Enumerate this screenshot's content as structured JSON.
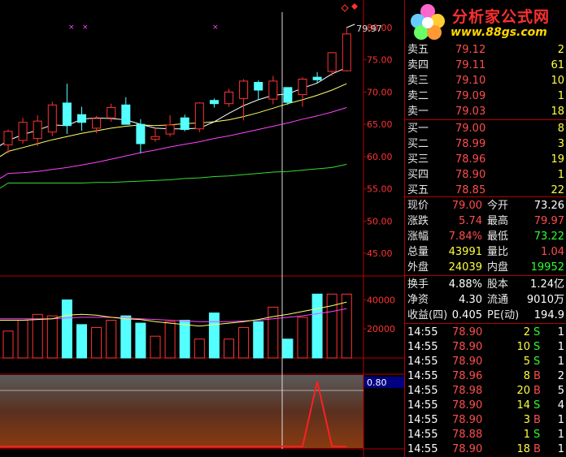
{
  "logo": {
    "title": "分析家公式网",
    "url": "www.88gs.com"
  },
  "price_axis": {
    "ticks": [
      "80.00",
      "75.00",
      "70.00",
      "65.00",
      "60.00",
      "55.00",
      "50.00",
      "45.00"
    ],
    "hi_label": "79.97"
  },
  "volume_axis": {
    "ticks": [
      "40000",
      "20000"
    ]
  },
  "indicator": {
    "value_label": "0.80"
  },
  "order_book": {
    "asks": [
      {
        "label": "卖五",
        "price": "79.12",
        "vol": "2"
      },
      {
        "label": "卖四",
        "price": "79.11",
        "vol": "61"
      },
      {
        "label": "卖三",
        "price": "79.10",
        "vol": "10"
      },
      {
        "label": "卖二",
        "price": "79.09",
        "vol": "1"
      },
      {
        "label": "卖一",
        "price": "79.03",
        "vol": "18"
      }
    ],
    "bids": [
      {
        "label": "买一",
        "price": "79.00",
        "vol": "8"
      },
      {
        "label": "买二",
        "price": "78.99",
        "vol": "3"
      },
      {
        "label": "买三",
        "price": "78.96",
        "vol": "19"
      },
      {
        "label": "买四",
        "price": "78.90",
        "vol": "1"
      },
      {
        "label": "买五",
        "price": "78.85",
        "vol": "22"
      }
    ]
  },
  "quote": [
    {
      "l1": "现价",
      "v1": "79.00",
      "l2": "今开",
      "v2": "73.26"
    },
    {
      "l1": "涨跌",
      "v1": "5.74",
      "l2": "最高",
      "v2": "79.97"
    },
    {
      "l1": "涨幅",
      "v1": "7.84%",
      "l2": "最低",
      "v2": "73.22"
    },
    {
      "l1": "总量",
      "v1": "43991",
      "l2": "量比",
      "v2": "1.04"
    },
    {
      "l1": "外盘",
      "v1": "24039",
      "l2": "内盘",
      "v2": "19952"
    }
  ],
  "fundamentals": [
    {
      "l1": "换手",
      "v1": "4.88%",
      "l2": "股本",
      "v2": "1.24亿"
    },
    {
      "l1": "净资",
      "v1": "4.30",
      "l2": "流通",
      "v2": "9010万"
    },
    {
      "l1": "收益(四)",
      "v1": "0.405",
      "l2": "PE(动)",
      "v2": "194.9"
    }
  ],
  "ticks": [
    {
      "time": "14:55",
      "price": "78.90",
      "vol": "2",
      "side": "S",
      "n": "1"
    },
    {
      "time": "14:55",
      "price": "78.90",
      "vol": "10",
      "side": "S",
      "n": "1"
    },
    {
      "time": "14:55",
      "price": "78.90",
      "vol": "5",
      "side": "S",
      "n": "1"
    },
    {
      "time": "14:55",
      "price": "78.96",
      "vol": "8",
      "side": "B",
      "n": "2"
    },
    {
      "time": "14:55",
      "price": "78.98",
      "vol": "20",
      "side": "B",
      "n": "5"
    },
    {
      "time": "14:55",
      "price": "78.90",
      "vol": "14",
      "side": "S",
      "n": "4"
    },
    {
      "time": "14:55",
      "price": "78.90",
      "vol": "3",
      "side": "B",
      "n": "1"
    },
    {
      "time": "14:55",
      "price": "78.88",
      "vol": "1",
      "side": "S",
      "n": "1"
    },
    {
      "time": "14:55",
      "price": "78.90",
      "vol": "18",
      "side": "B",
      "n": "1"
    }
  ],
  "colors": {
    "up": "#ff3333",
    "down": "#54ffff",
    "ma5": "#ffffff",
    "ma10": "#ffff66",
    "ma20": "#ff44ff",
    "ma60": "#33dd33",
    "grid": "#b30000"
  },
  "chart_data": {
    "type": "candlestick",
    "candles": [
      {
        "o": 61.8,
        "h": 64.2,
        "l": 60.5,
        "c": 63.9
      },
      {
        "o": 62.5,
        "h": 66.0,
        "l": 62.0,
        "c": 65.3
      },
      {
        "o": 62.8,
        "h": 66.4,
        "l": 61.6,
        "c": 65.5
      },
      {
        "o": 63.8,
        "h": 68.5,
        "l": 63.2,
        "c": 68.0
      },
      {
        "o": 68.3,
        "h": 71.3,
        "l": 63.5,
        "c": 64.8
      },
      {
        "o": 66.5,
        "h": 67.7,
        "l": 64.0,
        "c": 65.3
      },
      {
        "o": 64.4,
        "h": 66.3,
        "l": 63.6,
        "c": 65.9
      },
      {
        "o": 66.0,
        "h": 68.2,
        "l": 65.4,
        "c": 67.6
      },
      {
        "o": 68.0,
        "h": 69.2,
        "l": 65.7,
        "c": 65.0
      },
      {
        "o": 65.0,
        "h": 65.8,
        "l": 60.5,
        "c": 62.0
      },
      {
        "o": 62.7,
        "h": 64.5,
        "l": 62.3,
        "c": 63.1
      },
      {
        "o": 63.5,
        "h": 66.4,
        "l": 63.1,
        "c": 64.9
      },
      {
        "o": 66.0,
        "h": 66.5,
        "l": 63.9,
        "c": 64.2
      },
      {
        "o": 64.3,
        "h": 68.4,
        "l": 63.8,
        "c": 68.3
      },
      {
        "o": 68.7,
        "h": 69.0,
        "l": 67.6,
        "c": 68.2
      },
      {
        "o": 68.2,
        "h": 70.5,
        "l": 67.7,
        "c": 70.0
      },
      {
        "o": 69.0,
        "h": 72.0,
        "l": 65.6,
        "c": 71.7
      },
      {
        "o": 71.5,
        "h": 71.8,
        "l": 68.8,
        "c": 70.3
      },
      {
        "o": 68.9,
        "h": 72.5,
        "l": 68.1,
        "c": 71.7
      },
      {
        "o": 70.7,
        "h": 70.7,
        "l": 68.0,
        "c": 68.4
      },
      {
        "o": 69.6,
        "h": 72.3,
        "l": 67.7,
        "c": 72.0
      },
      {
        "o": 72.3,
        "h": 73.1,
        "l": 71.4,
        "c": 71.9
      },
      {
        "o": 73.2,
        "h": 76.2,
        "l": 72.5,
        "c": 76.1
      },
      {
        "o": 73.3,
        "h": 80.0,
        "l": 73.2,
        "c": 79.0
      }
    ],
    "ma5": [
      62.5,
      63.4,
      64.1,
      64.9,
      64.8,
      65.8,
      66.0,
      65.9,
      65.7,
      65.0,
      64.4,
      64.3,
      64.3,
      64.4,
      65.4,
      66.7,
      67.9,
      68.8,
      69.5,
      69.7,
      70.6,
      71.4,
      72.8,
      73.8
    ],
    "ma10": [
      60.8,
      61.4,
      62.0,
      62.6,
      63.1,
      63.6,
      64.0,
      64.4,
      64.7,
      64.9,
      64.8,
      64.9,
      65.1,
      65.2,
      65.4,
      65.7,
      66.2,
      66.8,
      67.5,
      68.2,
      68.8,
      69.5,
      70.3,
      71.3
    ],
    "ma20": [
      57.4,
      57.5,
      57.7,
      58.0,
      58.3,
      58.7,
      59.1,
      59.6,
      60.1,
      60.6,
      61.0,
      61.5,
      61.9,
      62.3,
      62.8,
      63.2,
      63.7,
      64.2,
      64.7,
      65.2,
      65.8,
      66.3,
      66.9,
      67.6
    ],
    "ma60": [
      55.9,
      55.9,
      55.9,
      55.9,
      55.9,
      55.9,
      56.0,
      56.0,
      56.1,
      56.2,
      56.3,
      56.4,
      56.6,
      56.7,
      56.9,
      57.0,
      57.2,
      57.4,
      57.6,
      57.7,
      57.9,
      58.1,
      58.3,
      58.8
    ],
    "volumes": [
      18500,
      26000,
      30000,
      29000,
      40000,
      23000,
      21000,
      26000,
      29000,
      24000,
      15000,
      25000,
      26000,
      13000,
      31000,
      13000,
      21000,
      25000,
      35000,
      13000,
      28000,
      44000,
      44000,
      43991
    ],
    "vol_ma1": [
      26000,
      26000,
      26500,
      27000,
      29500,
      30000,
      29500,
      28000,
      27000,
      26500,
      25000,
      24000,
      23000,
      22000,
      23000,
      24000,
      25000,
      26500,
      28500,
      30000,
      32000,
      34000,
      36000,
      38500
    ],
    "vol_ma2": [
      27000,
      27000,
      27000,
      27000,
      27500,
      28000,
      28000,
      28000,
      27500,
      27000,
      26500,
      26000,
      25500,
      25000,
      25000,
      25000,
      25500,
      26000,
      27000,
      28000,
      29000,
      30500,
      32000,
      34000
    ],
    "indicator_values": [
      0,
      0,
      0,
      0,
      0,
      0,
      0,
      0,
      0,
      0,
      0,
      0,
      0,
      0,
      0,
      0,
      0,
      0,
      0,
      0,
      0,
      1,
      0,
      0
    ],
    "price_ylim": [
      42.5,
      82.0
    ],
    "volume_ylim": [
      0,
      52000
    ],
    "indicator_ylim": [
      0,
      1
    ]
  }
}
